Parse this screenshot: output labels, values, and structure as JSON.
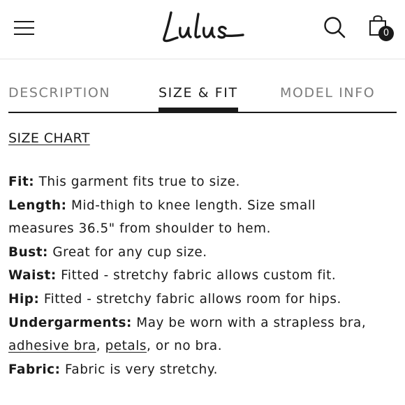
{
  "header": {
    "brand": "Lulus",
    "cart_count": "0",
    "icons": {
      "menu": "hamburger-menu-icon",
      "search": "search-icon",
      "cart": "shopping-bag-icon"
    }
  },
  "tabs": [
    {
      "label": "DESCRIPTION",
      "active": false
    },
    {
      "label": "SIZE & FIT",
      "active": true
    },
    {
      "label": "MODEL INFO",
      "active": false
    }
  ],
  "size_chart_link": "SIZE CHART",
  "details": {
    "fit": {
      "label": "Fit:",
      "text": " This garment fits true to size."
    },
    "length": {
      "label": "Length:",
      "text_1": " Mid-thigh to knee length. Size small",
      "text_2": "measures 36.5\" from shoulder to hem."
    },
    "bust": {
      "label": "Bust:",
      "text": " Great for any cup size."
    },
    "waist": {
      "label": "Waist:",
      "text": " Fitted - stretchy fabric allows custom fit."
    },
    "hip": {
      "label": "Hip:",
      "text": " Fitted - stretchy fabric allows room for hips."
    },
    "undergarments": {
      "label": "Undergarments:",
      "text_1": " May be worn with a strapless bra,",
      "link_1": "adhesive bra",
      "sep_1": ", ",
      "link_2": "petals",
      "text_2": ", or no bra."
    },
    "fabric": {
      "label": "Fabric:",
      "text": " Fabric is very stretchy."
    }
  },
  "colors": {
    "text": "#1a1a1a",
    "inactive_tab": "#7c7c7c",
    "divider": "#e4e4e4"
  }
}
